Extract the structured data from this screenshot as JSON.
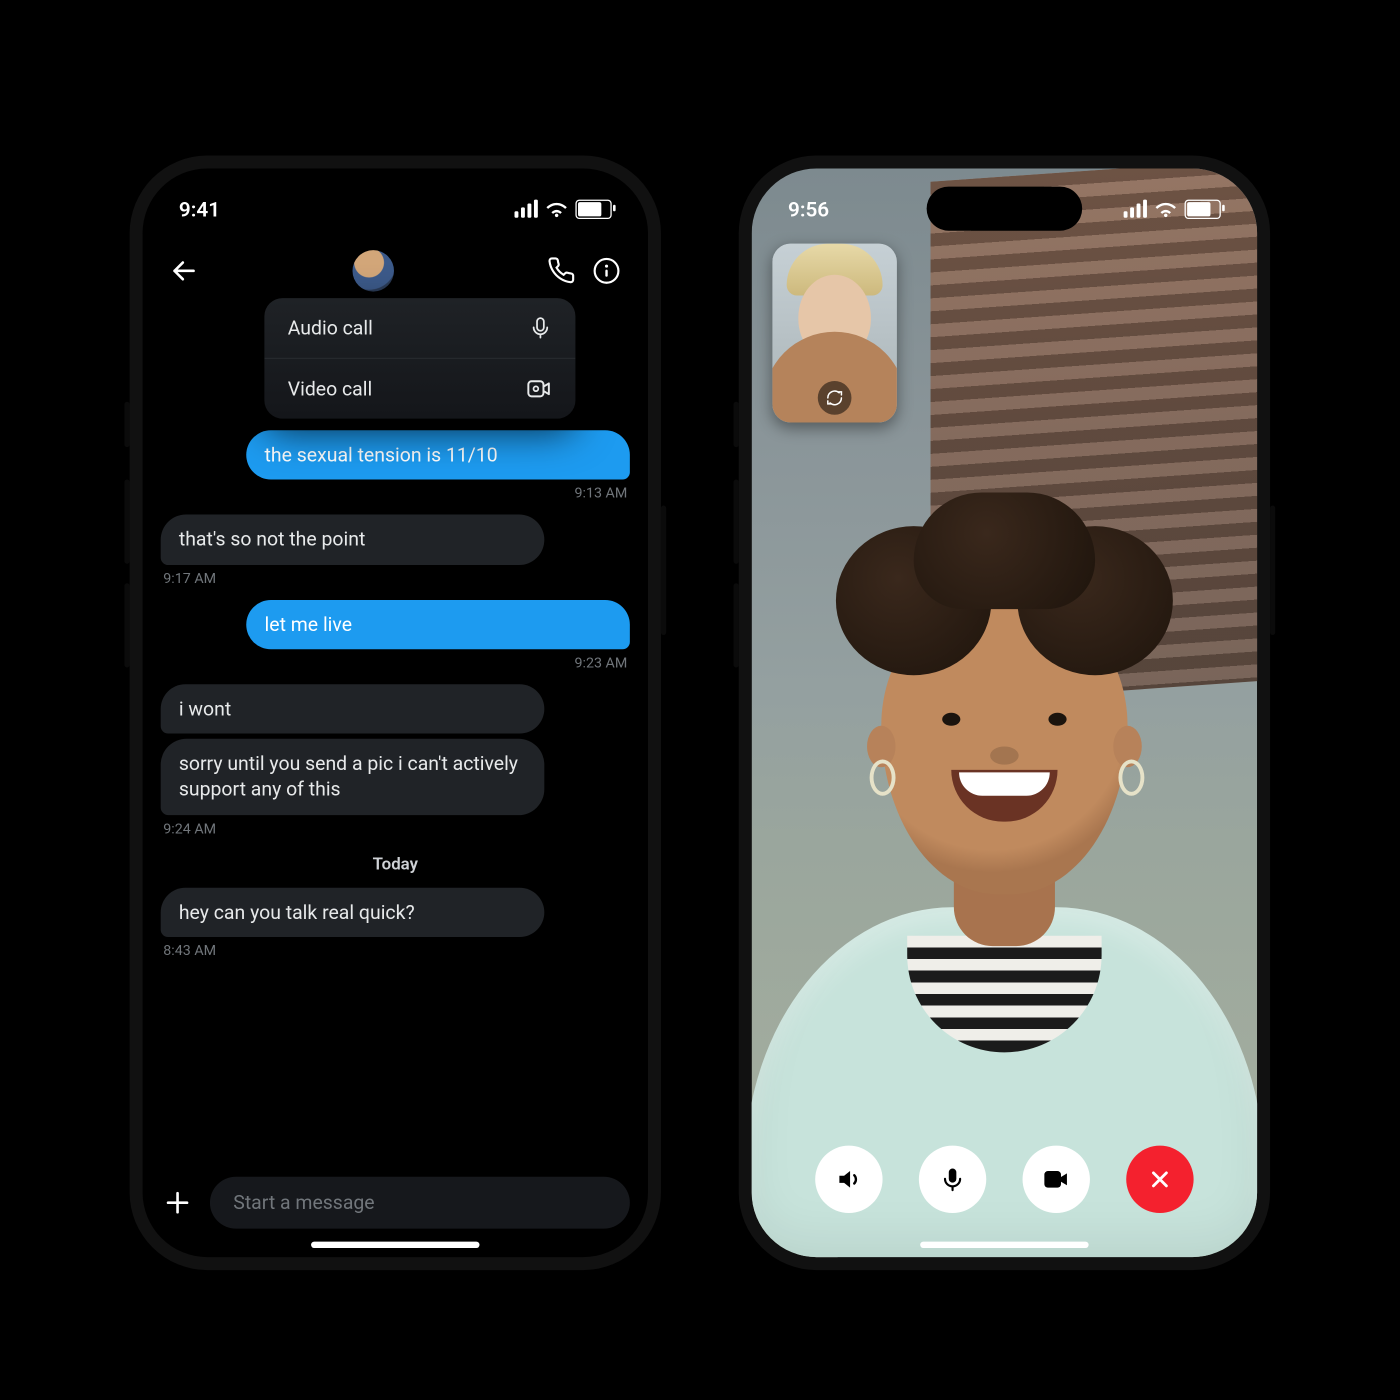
{
  "left": {
    "status": {
      "time": "9:41"
    },
    "call_menu": {
      "audio_label": "Audio call",
      "video_label": "Video call"
    },
    "messages": [
      {
        "side": "out",
        "text": "the sexual tension is 11/10"
      },
      {
        "ts": "r",
        "time": "9:13 AM"
      },
      {
        "side": "in",
        "text": "that's so not the point"
      },
      {
        "ts": "l",
        "time": "9:17 AM"
      },
      {
        "side": "out",
        "text": "let me live"
      },
      {
        "ts": "r",
        "time": "9:23 AM"
      },
      {
        "side": "in",
        "text": "i wont"
      },
      {
        "side": "in",
        "text": "sorry until you send a pic i can't actively support any of this"
      },
      {
        "ts": "l",
        "time": "9:24 AM"
      },
      {
        "sep": true,
        "label": "Today"
      },
      {
        "side": "in",
        "text": "hey can you talk real quick?"
      },
      {
        "ts": "l",
        "time": "8:43 AM"
      }
    ],
    "composer": {
      "placeholder": "Start a message"
    }
  },
  "right": {
    "status": {
      "time": "9:56"
    },
    "controls": {
      "speaker": "speaker-button",
      "mute": "mute-button",
      "camera": "camera-button",
      "end": "end-call-button"
    }
  },
  "colors": {
    "accent": "#1d9bf0",
    "end_call": "#f4212e"
  }
}
